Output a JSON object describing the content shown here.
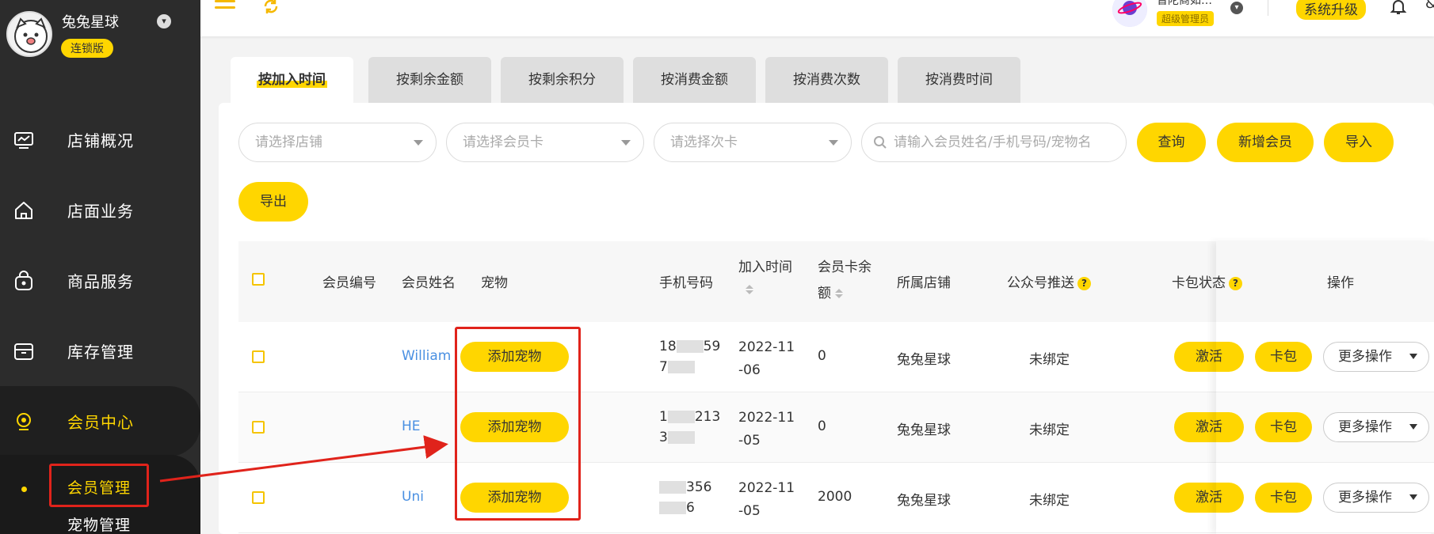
{
  "sidebar": {
    "brand_name": "兔兔星球",
    "brand_badge": "连锁版",
    "items": [
      {
        "label": "店铺概况",
        "icon": "monitor-icon"
      },
      {
        "label": "店面业务",
        "icon": "home-icon"
      },
      {
        "label": "商品服务",
        "icon": "bag-icon"
      },
      {
        "label": "库存管理",
        "icon": "inventory-icon"
      },
      {
        "label": "会员中心",
        "icon": "member-icon"
      }
    ],
    "sub_items": [
      "会员管理",
      "宠物管理"
    ]
  },
  "topbar": {
    "user_name": "普陀商如…",
    "user_role": "超级管理员",
    "upgrade_label": "系统升级",
    "clipped_right": "&"
  },
  "tabs": [
    "按加入时间",
    "按剩余金额",
    "按剩余积分",
    "按消费金额",
    "按消费次数",
    "按消费时间"
  ],
  "filters": {
    "store_placeholder": "请选择店铺",
    "card_placeholder": "请选择会员卡",
    "times_card_placeholder": "请选择次卡",
    "search_placeholder": "请输入会员姓名/手机号码/宠物名"
  },
  "buttons": {
    "query": "查询",
    "add_member": "新增会员",
    "import": "导入",
    "export": "导出"
  },
  "table": {
    "headers": {
      "member_no": "会员编号",
      "member_name": "会员姓名",
      "pet": "宠物",
      "phone": "手机号码",
      "join_time": "加入时间",
      "balance_1": "会员卡余",
      "balance_2": "额",
      "store": "所属店铺",
      "wechat_push": "公众号推送",
      "card_status": "卡包状态",
      "actions": "操作"
    },
    "rows": [
      {
        "name": "William",
        "pet_btn": "添加宠物",
        "phone_1": "18",
        "phone_1b": "59",
        "phone_2b": "7",
        "date_1": "2022-11",
        "date_2": "-06",
        "balance": "0",
        "store": "兔兔星球",
        "push": "未绑定",
        "activate": "激活",
        "wallet": "卡包",
        "more": "更多操作"
      },
      {
        "name": "HE",
        "pet_btn": "添加宠物",
        "phone_1": "1",
        "phone_1b": "213",
        "phone_2b": "3",
        "date_1": "2022-11",
        "date_2": "-05",
        "balance": "0",
        "store": "兔兔星球",
        "push": "未绑定",
        "activate": "激活",
        "wallet": "卡包",
        "more": "更多操作"
      },
      {
        "name": "Uni",
        "pet_btn": "添加宠物",
        "phone_1": "",
        "phone_1b": "356",
        "phone_2b": "6",
        "date_1": "2022-11",
        "date_2": "-05",
        "balance": "2000",
        "store": "兔兔星球",
        "push": "未绑定",
        "activate": "激活",
        "wallet": "卡包",
        "more": "更多操作"
      }
    ]
  },
  "colors": {
    "accent": "#ffd600",
    "sidebar": "#2c2c2c",
    "link": "#4a90e2",
    "annotation": "#e0231b"
  }
}
